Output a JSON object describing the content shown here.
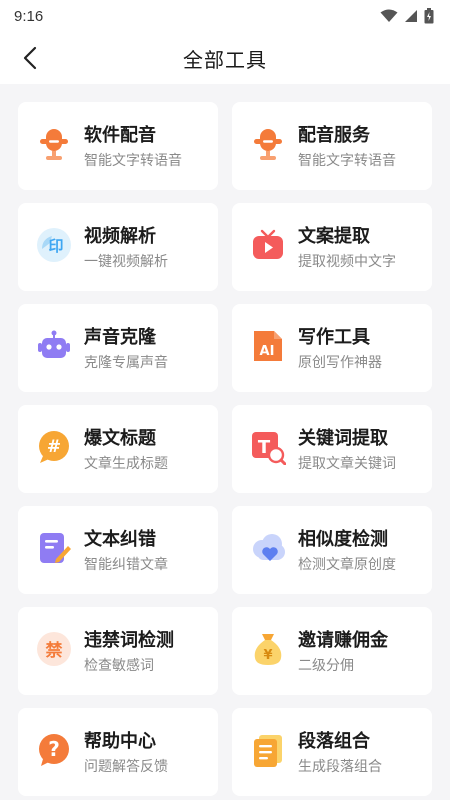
{
  "status_bar": {
    "time": "9:16"
  },
  "header": {
    "title": "全部工具"
  },
  "tools": [
    {
      "title": "软件配音",
      "subtitle": "智能文字转语音",
      "icon": "microphone-icon"
    },
    {
      "title": "配音服务",
      "subtitle": "智能文字转语音",
      "icon": "microphone-icon"
    },
    {
      "title": "视频解析",
      "subtitle": "一键视频解析",
      "icon": "seal-icon",
      "icon_glyph": "印"
    },
    {
      "title": "文案提取",
      "subtitle": "提取视频中文字",
      "icon": "tv-play-icon"
    },
    {
      "title": "声音克隆",
      "subtitle": "克隆专属声音",
      "icon": "robot-icon"
    },
    {
      "title": "写作工具",
      "subtitle": "原创写作神器",
      "icon": "ai-document-icon",
      "icon_glyph": "AI"
    },
    {
      "title": "爆文标题",
      "subtitle": "文章生成标题",
      "icon": "hashtag-bubble-icon",
      "icon_glyph": "#"
    },
    {
      "title": "关键词提取",
      "subtitle": "提取文章关键词",
      "icon": "keyword-extract-icon",
      "icon_glyph": "T"
    },
    {
      "title": "文本纠错",
      "subtitle": "智能纠错文章",
      "icon": "edit-document-icon"
    },
    {
      "title": "相似度检测",
      "subtitle": "检测文章原创度",
      "icon": "heart-cloud-icon"
    },
    {
      "title": "违禁词检测",
      "subtitle": "检查敏感词",
      "icon": "forbidden-word-icon",
      "icon_glyph": "禁"
    },
    {
      "title": "邀请赚佣金",
      "subtitle": "二级分佣",
      "icon": "money-bag-icon",
      "icon_glyph": "¥"
    },
    {
      "title": "帮助中心",
      "subtitle": "问题解答反馈",
      "icon": "help-question-icon",
      "icon_glyph": "?"
    },
    {
      "title": "段落组合",
      "subtitle": "生成段落组合",
      "icon": "paragraph-document-icon"
    }
  ],
  "colors": {
    "orange": "#f47b3a",
    "red": "#f45b5b",
    "blue": "#3ea6f2",
    "purple": "#8f7cf3"
  }
}
